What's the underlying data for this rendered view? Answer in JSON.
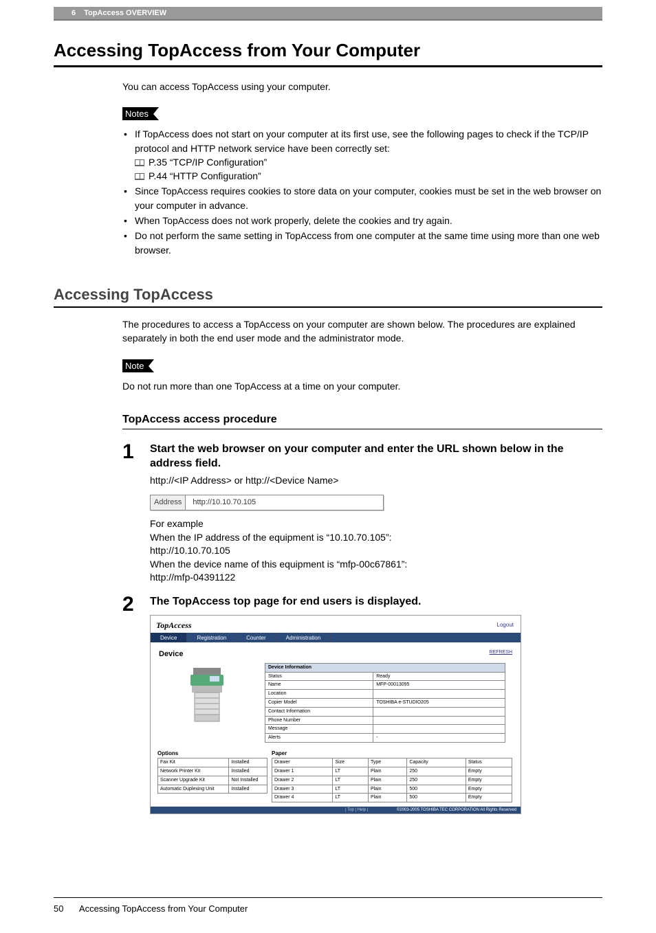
{
  "header": {
    "chapter_num": "6",
    "chapter_title": "TopAccess OVERVIEW"
  },
  "h1": "Accessing TopAccess from Your Computer",
  "intro": "You can access TopAccess using your computer.",
  "notes_label_plural": "Notes",
  "notes_label_single": "Note",
  "notes": {
    "n1_a": "If TopAccess does not start on your computer at its first use, see the following pages to check if the TCP/IP protocol and HTTP network service have been correctly set:",
    "n1_ref1": "P.35 “TCP/IP Configuration”",
    "n1_ref2": "P.44 “HTTP Configuration”",
    "n2": "Since TopAccess requires cookies to store data on your computer, cookies must be set in the web browser on your computer in advance.",
    "n3": "When TopAccess does not work properly, delete the cookies and try again.",
    "n4": "Do not perform the same setting in TopAccess from one computer at the same time using more than one web browser."
  },
  "h2": "Accessing TopAccess",
  "h2_para": "The procedures to access a TopAccess on your computer are shown below. The procedures are explained separately in both the end user mode and the administrator mode.",
  "single_note": "Do not run more than one TopAccess at a time on your computer.",
  "h3": "TopAccess access procedure",
  "steps": {
    "s1": {
      "num": "1",
      "title": "Start the web browser on your computer and enter the URL shown below in the address field.",
      "line1": "http://<IP Address> or http://<Device Name>",
      "addr_label": "Address",
      "addr_value": "http://10.10.70.105",
      "eg_label": "For example",
      "eg1": "When the IP address of the equipment is “10.10.70.105”:",
      "eg1_url": "http://10.10.70.105",
      "eg2": "When the device name of this equipment is “mfp-00c67861”:",
      "eg2_url": "http://mfp-04391122"
    },
    "s2": {
      "num": "2",
      "title": "The TopAccess top page for end users is displayed."
    }
  },
  "shot": {
    "logo": "TopAccess",
    "logout": "Logout",
    "tabs": [
      "Device",
      "Registration",
      "Counter",
      "Administration"
    ],
    "device_title": "Device",
    "refresh": "REFRESH",
    "info_header": "Device Information",
    "info_rows": [
      [
        "Status",
        "Ready"
      ],
      [
        "Name",
        "MFP-00013095"
      ],
      [
        "Location",
        ""
      ],
      [
        "Copier Model",
        "TOSHIBA e-STUDIO205"
      ],
      [
        "Contact Information",
        ""
      ],
      [
        "Phone Number",
        ""
      ],
      [
        "Message",
        ""
      ],
      [
        "Alerts",
        "-"
      ]
    ],
    "options_label": "Options",
    "options": [
      [
        "Fax Kit",
        "Installed"
      ],
      [
        "Network Printer Kit",
        "Installed"
      ],
      [
        "Scanner Upgrade Kit",
        "Not Installed"
      ],
      [
        "Automatic Duplexing Unit",
        "Installed"
      ]
    ],
    "paper_label": "Paper",
    "paper_headers": [
      "Drawer",
      "Size",
      "Type",
      "Capacity",
      "Status"
    ],
    "paper_rows": [
      [
        "Drawer 1",
        "LT",
        "Plain",
        "250",
        "Empty"
      ],
      [
        "Drawer 2",
        "LT",
        "Plain",
        "250",
        "Empty"
      ],
      [
        "Drawer 3",
        "LT",
        "Plain",
        "500",
        "Empty"
      ],
      [
        "Drawer 4",
        "LT",
        "Plain",
        "500",
        "Empty"
      ]
    ],
    "footer_links": "| Top | Help |",
    "footer_copy": "©2003-2005 TOSHIBA TEC CORPORATION All Rights Reserved"
  },
  "footer": {
    "page_num": "50",
    "title": "Accessing TopAccess from Your Computer"
  }
}
